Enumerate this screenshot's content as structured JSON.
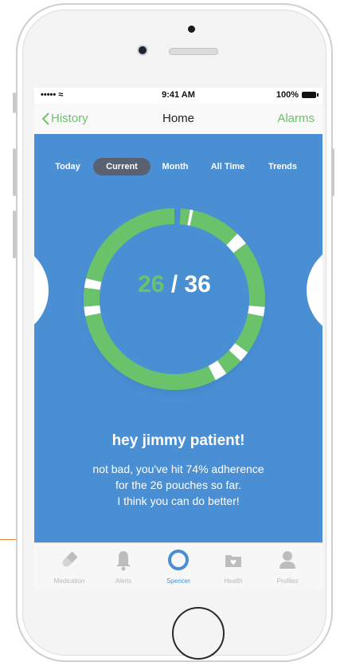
{
  "status_bar": {
    "signal": "••••• ≈",
    "time": "9:41 AM",
    "battery": "100%"
  },
  "nav": {
    "back_label": "History",
    "title": "Home",
    "right_label": "Alarms"
  },
  "tabs": [
    {
      "label": "Today",
      "active": false
    },
    {
      "label": "Current",
      "active": true
    },
    {
      "label": "Month",
      "active": false
    },
    {
      "label": "All Time",
      "active": false
    },
    {
      "label": "Trends",
      "active": false
    }
  ],
  "progress": {
    "taken": "26",
    "separator": " / ",
    "total": "36",
    "fraction": 0.72
  },
  "greeting": "hey jimmy patient!",
  "message": {
    "line1": "not bad, you've hit 74% adherence",
    "line2": "for the 26 pouches so far.",
    "line3": "I think you can do better!"
  },
  "tab_bar": [
    {
      "label": "Medication",
      "icon": "pill-icon",
      "active": false
    },
    {
      "label": "Alerts",
      "icon": "bell-icon",
      "active": false
    },
    {
      "label": "Spencer",
      "icon": "ring-icon",
      "active": true
    },
    {
      "label": "Health",
      "icon": "folder-heart-icon",
      "active": false
    },
    {
      "label": "Profiles",
      "icon": "person-icon",
      "active": false
    }
  ],
  "colors": {
    "accent_green": "#6ac36a",
    "background_blue": "#4a8fd4",
    "active_tab": "#5a6170"
  }
}
